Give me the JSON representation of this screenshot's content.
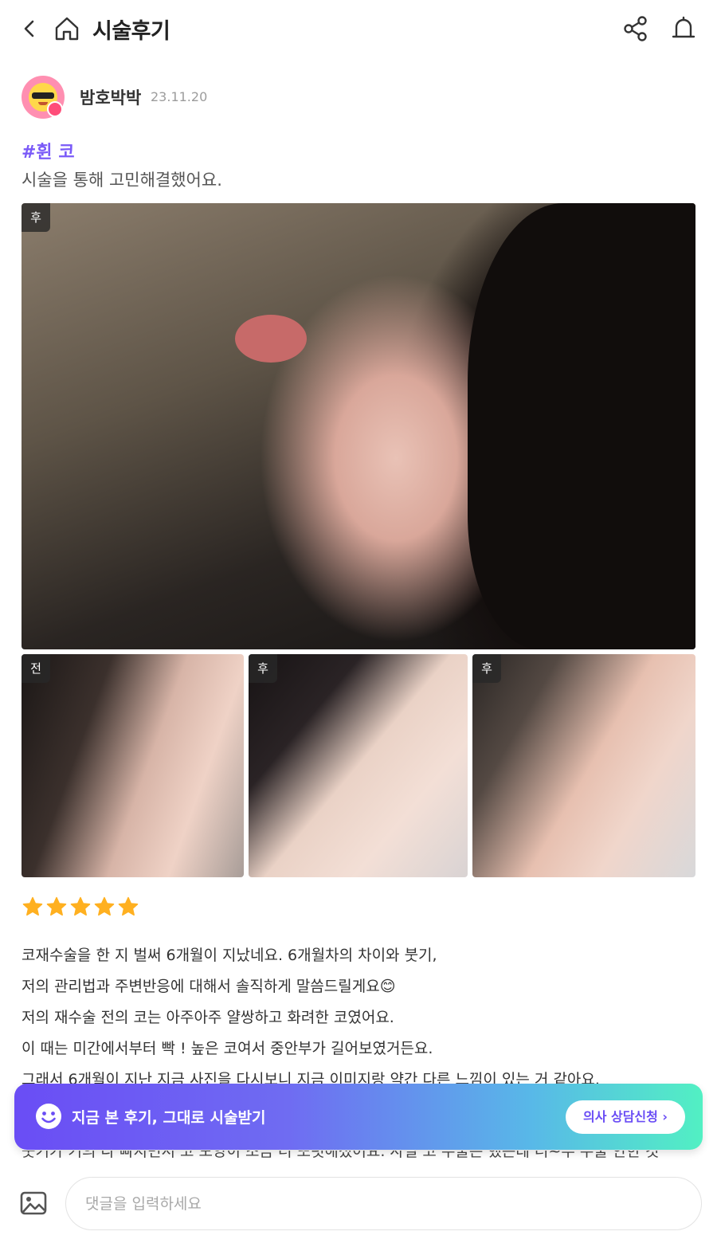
{
  "header": {
    "title": "시술후기"
  },
  "author": {
    "name": "밤호박박",
    "date": "23.11.20"
  },
  "post": {
    "tag": "#휜 코",
    "summary": "시술을 통해 고민해결했어요.",
    "photos": [
      {
        "label": "후"
      },
      {
        "label": "전"
      },
      {
        "label": "후"
      },
      {
        "label": "후"
      }
    ],
    "rating": 5,
    "body_lines": [
      "코재수술을 한 지 벌써 6개월이 지났네요. 6개월차의 차이와 붓기,",
      "저의 관리법과 주변반응에 대해서 솔직하게 말씀드릴게요😊",
      "저의 재수술 전의 코는 아주아주 얄쌍하고 화려한 코였어요.",
      "이 때는 미간에서부터 빡 ! 높은 코여서 중안부가 길어보였거든요.",
      "그래서 6개월이 지난 지금 사진을 다시보니 지금 이미지랑 약간 다른 느낌이 있는 거 같아요."
    ],
    "peek_line": "붓기가 거의 다 빠지면서 코 모양이 조금 더 또렷해졌어요. 사실 코 수술은 했는데 너~무 수술 안한 것"
  },
  "cta": {
    "text": "지금 본 후기, 그대로 시술받기",
    "consult_label": "의사 상담신청 ›"
  },
  "composer": {
    "placeholder": "댓글을 입력하세요"
  },
  "colors": {
    "accent": "#7a5af8",
    "star": "#ffb020",
    "cta_start": "#6a4df5",
    "cta_end": "#52f0c3"
  }
}
